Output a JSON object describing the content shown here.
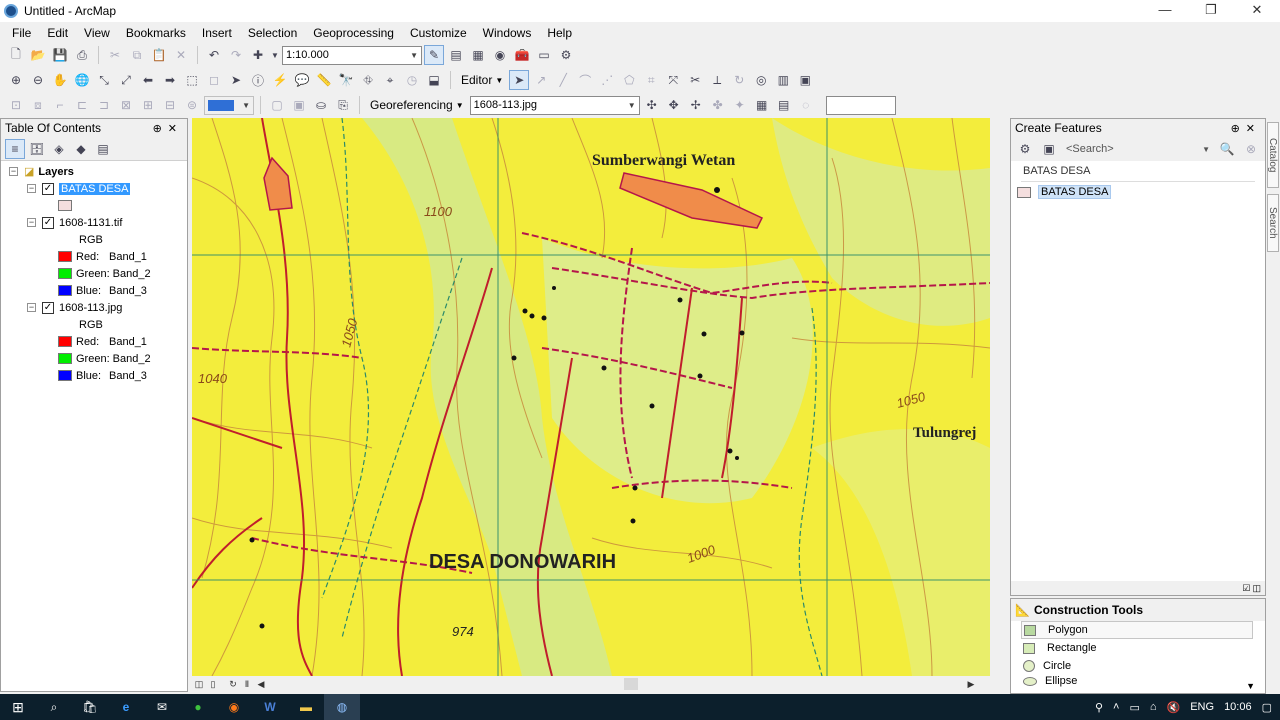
{
  "window": {
    "title": "Untitled - ArcMap",
    "controls": [
      "—",
      "❐",
      "✕"
    ]
  },
  "menu": [
    "File",
    "Edit",
    "View",
    "Bookmarks",
    "Insert",
    "Selection",
    "Geoprocessing",
    "Customize",
    "Windows",
    "Help"
  ],
  "toolbar": {
    "scale": "1:10.000",
    "editor_label": "Editor",
    "georef_label": "Georeferencing",
    "georef_layer": "1608-113.jpg"
  },
  "toc": {
    "title": "Table Of Contents",
    "root": "Layers",
    "layers": [
      {
        "name": "BATAS DESA",
        "checked": true,
        "selected": true
      },
      {
        "name": "1608-1131.tif",
        "checked": true,
        "type": "RGB",
        "bands": [
          {
            "channel": "Red:",
            "band": "Band_1",
            "color": "#ff0000"
          },
          {
            "channel": "Green:",
            "band": "Band_2",
            "color": "#00ee00"
          },
          {
            "channel": "Blue:",
            "band": "Band_3",
            "color": "#0000ff"
          }
        ]
      },
      {
        "name": "1608-113.jpg",
        "checked": true,
        "type": "RGB",
        "bands": [
          {
            "channel": "Red:",
            "band": "Band_1",
            "color": "#ff0000"
          },
          {
            "channel": "Green:",
            "band": "Band_2",
            "color": "#00ee00"
          },
          {
            "channel": "Blue:",
            "band": "Band_3",
            "color": "#0000ff"
          }
        ]
      }
    ]
  },
  "map": {
    "labels": {
      "village_top": "Sumberwangi Wetan",
      "village_main": "DESA DONOWARIH",
      "village_right": "Tulungrej",
      "elev_1100": "1100",
      "elev_1050_left": "1050",
      "elev_1040": "1040",
      "elev_1050_right": "1050",
      "elev_1000": "1000",
      "elev_974": "974"
    }
  },
  "create_features": {
    "title": "Create Features",
    "search_placeholder": "<Search>",
    "group": "BATAS DESA",
    "template": "BATAS DESA"
  },
  "construction_tools": {
    "title": "Construction Tools",
    "tools": [
      "Polygon",
      "Rectangle",
      "Circle",
      "Ellipse"
    ]
  },
  "side_tabs": [
    "Catalog",
    "Search"
  ],
  "taskbar": {
    "lang": "ENG",
    "time": "10:06"
  }
}
